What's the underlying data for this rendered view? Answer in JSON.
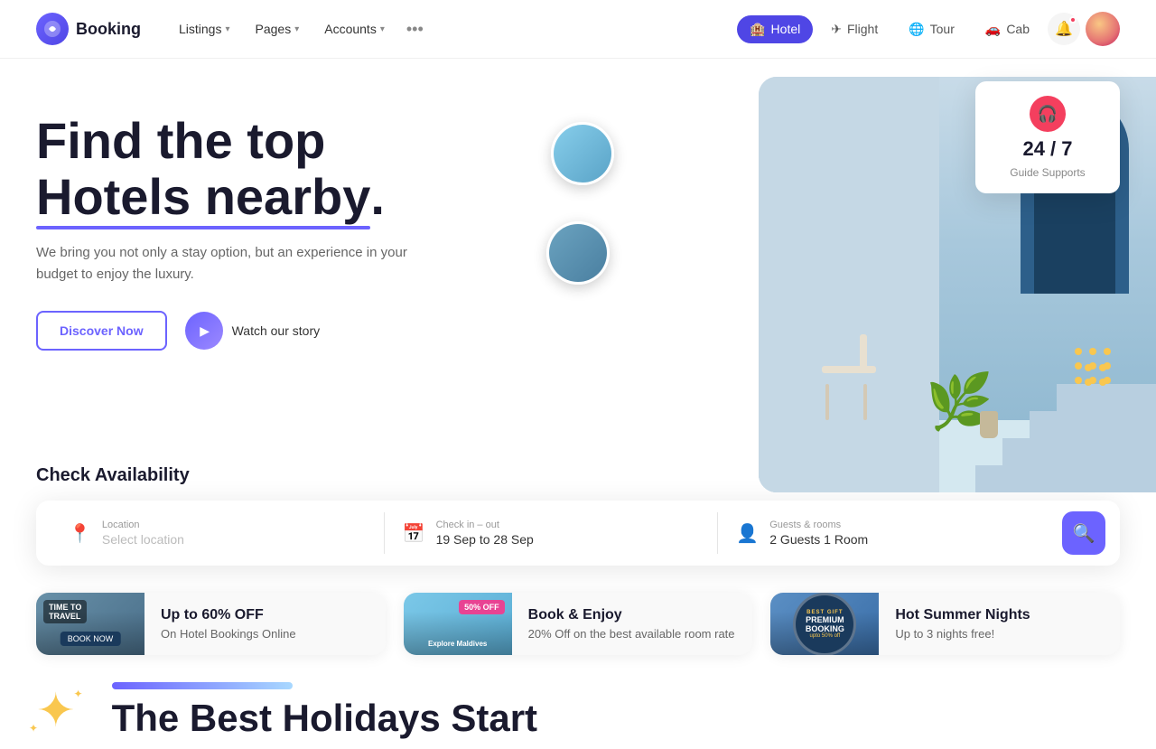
{
  "brand": {
    "name": "Booking",
    "logo_symbol": "✈"
  },
  "navbar": {
    "links": [
      {
        "id": "listings",
        "label": "Listings",
        "has_dropdown": true
      },
      {
        "id": "pages",
        "label": "Pages",
        "has_dropdown": true
      },
      {
        "id": "accounts",
        "label": "Accounts",
        "has_dropdown": true
      }
    ],
    "more_label": "•••",
    "tabs": [
      {
        "id": "hotel",
        "label": "Hotel",
        "icon": "🏨",
        "active": true
      },
      {
        "id": "flight",
        "label": "Flight",
        "icon": "✈",
        "active": false
      },
      {
        "id": "tour",
        "label": "Tour",
        "icon": "🌐",
        "active": false
      },
      {
        "id": "cab",
        "label": "Cab",
        "icon": "🚗",
        "active": false
      }
    ]
  },
  "hero": {
    "title_line1": "Find the top",
    "title_line2": "Hotels nearby.",
    "underline_word": "Hotels nearby",
    "description": "We bring you not only a stay option, but an experience in your budget to enjoy the luxury.",
    "btn_discover": "Discover Now",
    "btn_watch": "Watch our story"
  },
  "support_card": {
    "availability": "24 / 7",
    "label": "Guide Supports"
  },
  "search": {
    "section_title": "Check Availability",
    "location_label": "Location",
    "location_placeholder": "Select location",
    "checkin_label": "Check in – out",
    "checkin_value": "19 Sep to 28 Sep",
    "guests_label": "Guests & rooms",
    "guests_value": "2 Guests 1 Room"
  },
  "promo_cards": [
    {
      "id": "card1",
      "title": "Up to 60% OFF",
      "subtitle": "On Hotel Bookings Online",
      "badge": "TIME TO TRAVEL",
      "img_style": "bg1"
    },
    {
      "id": "card2",
      "title": "Book & Enjoy",
      "subtitle": "20% Off on the best available room rate",
      "badge": "50% OFF",
      "img_style": "bg2"
    },
    {
      "id": "card3",
      "title": "Hot Summer Nights",
      "subtitle": "Up to 3 nights free!",
      "badge": "PREMIUM BOOKING",
      "img_style": "bg3"
    }
  ],
  "bottom": {
    "title_start": "The Best Holidays Start"
  },
  "colors": {
    "accent": "#6c63ff",
    "accent_dark": "#4f46e5",
    "yellow": "#f9c74f",
    "red": "#f43f5e"
  }
}
